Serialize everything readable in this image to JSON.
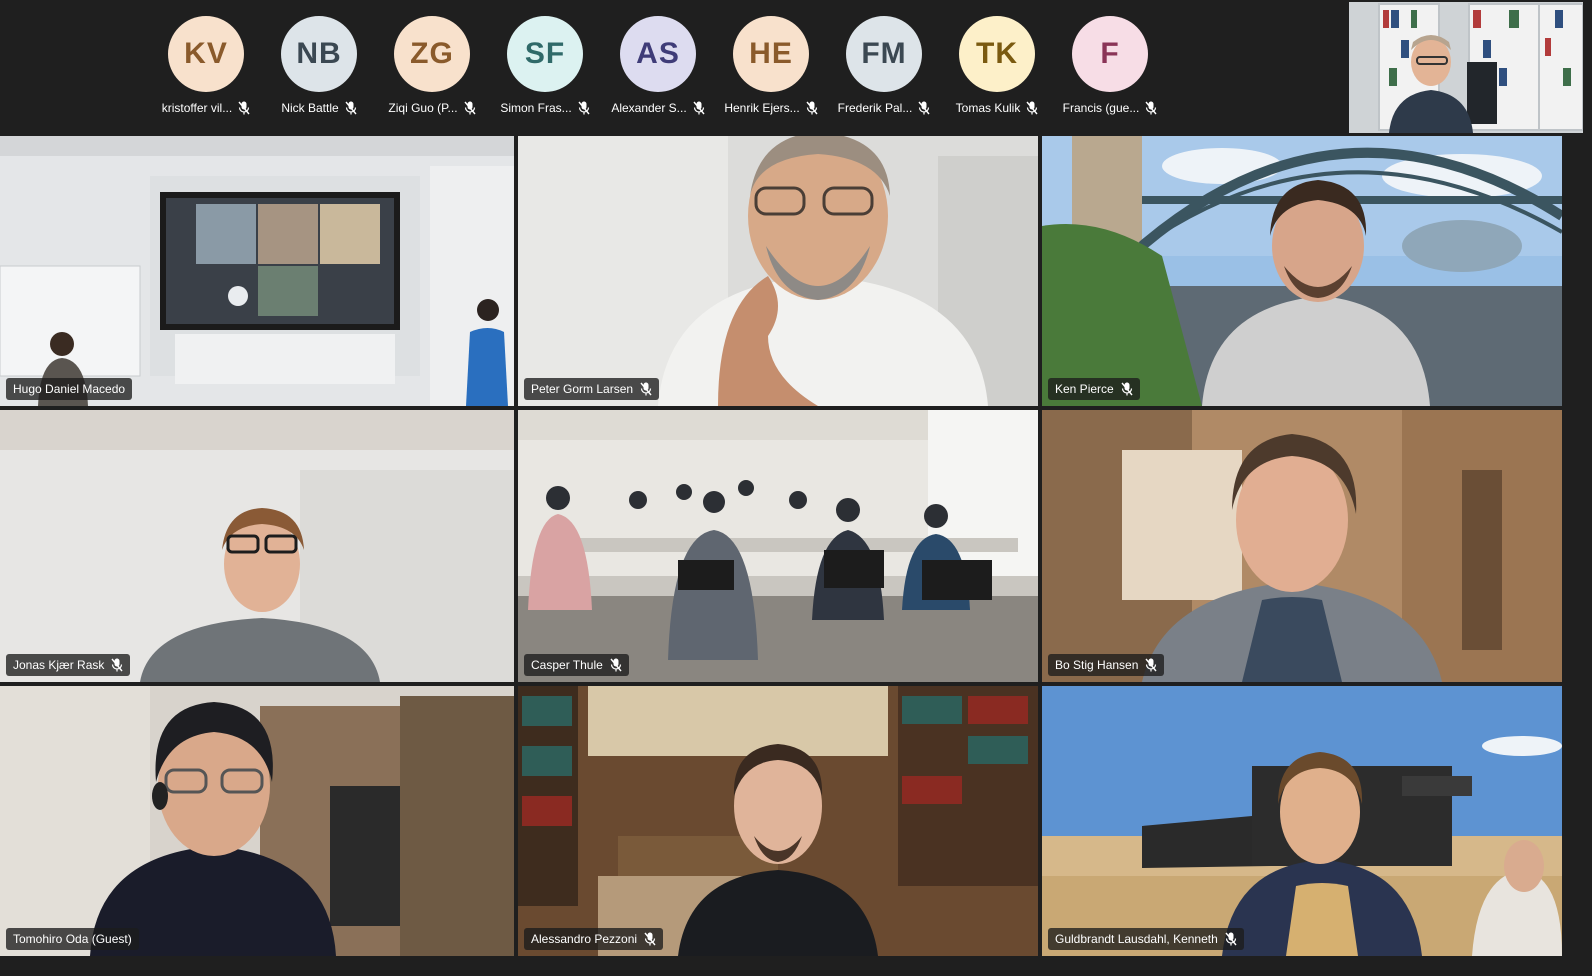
{
  "participants_strip": [
    {
      "initials": "KV",
      "name": "kristoffer vil...",
      "color": "#f8e1cc",
      "text_color": "#8a5a2b"
    },
    {
      "initials": "NB",
      "name": "Nick Battle",
      "color": "#dde4e9",
      "text_color": "#3b4852"
    },
    {
      "initials": "ZG",
      "name": "Ziqi Guo (P...",
      "color": "#f8e1cc",
      "text_color": "#8a5a2b"
    },
    {
      "initials": "SF",
      "name": "Simon Fras...",
      "color": "#dcf2f1",
      "text_color": "#2f6a69"
    },
    {
      "initials": "AS",
      "name": "Alexander S...",
      "color": "#dddcf0",
      "text_color": "#3f3c78"
    },
    {
      "initials": "HE",
      "name": "Henrik Ejers...",
      "color": "#f8e1cc",
      "text_color": "#8a5a2b"
    },
    {
      "initials": "FM",
      "name": "Frederik Pal...",
      "color": "#dde4e9",
      "text_color": "#3b4852"
    },
    {
      "initials": "TK",
      "name": "Tomas Kulik",
      "color": "#fdf0c9",
      "text_color": "#7a5a10"
    },
    {
      "initials": "F",
      "name": "Francis (gue...",
      "color": "#f7dde6",
      "text_color": "#8a3457"
    }
  ],
  "tiles": [
    {
      "name": "Hugo Daniel Macedo",
      "muted": false
    },
    {
      "name": "Peter Gorm Larsen",
      "muted": true
    },
    {
      "name": "Ken Pierce",
      "muted": true
    },
    {
      "name": "Jonas Kjær Rask",
      "muted": true
    },
    {
      "name": "Casper Thule",
      "muted": true
    },
    {
      "name": "Bo Stig Hansen",
      "muted": true
    },
    {
      "name": "Tomohiro Oda (Guest)",
      "muted": false
    },
    {
      "name": "Alessandro Pezzoni",
      "muted": true
    },
    {
      "name": "Guldbrandt Lausdahl, Kenneth",
      "muted": true
    }
  ],
  "icons": {
    "mic_off": "mic-off-icon"
  }
}
